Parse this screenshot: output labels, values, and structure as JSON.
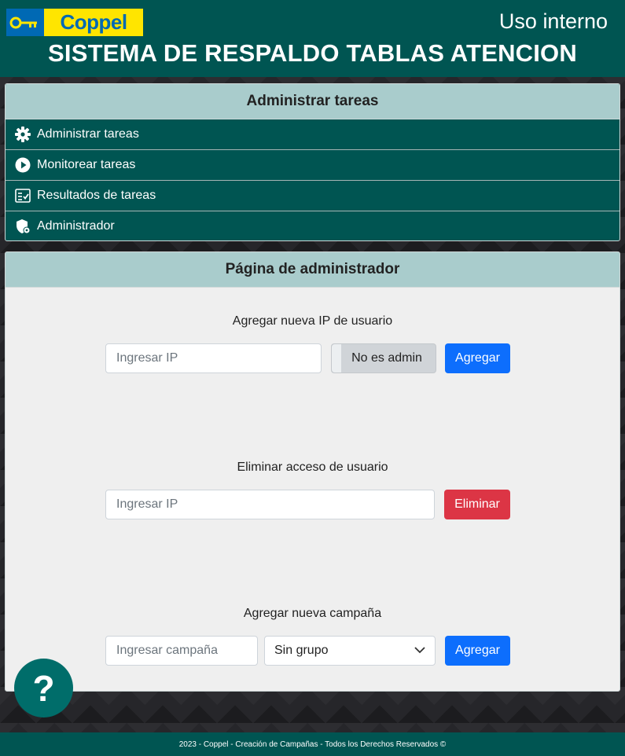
{
  "header": {
    "brand": "Coppel",
    "tag": "Uso interno",
    "title": "SISTEMA DE RESPALDO TABLAS ATENCION"
  },
  "menu": {
    "title": "Administrar tareas",
    "items": [
      {
        "label": "Administrar tareas",
        "icon": "gear-icon"
      },
      {
        "label": "Monitorear tareas",
        "icon": "play-circle-icon"
      },
      {
        "label": "Resultados de tareas",
        "icon": "checklist-icon"
      },
      {
        "label": "Administrador",
        "icon": "admin-shield-icon"
      }
    ]
  },
  "admin": {
    "title": "Página de administrador",
    "add_ip": {
      "label": "Agregar nueva IP de usuario",
      "placeholder": "Ingresar IP",
      "toggle_label": "No es admin",
      "button": "Agregar"
    },
    "remove": {
      "label": "Eliminar acceso de usuario",
      "placeholder": "Ingresar IP",
      "button": "Eliminar"
    },
    "campaign": {
      "label": "Agregar nueva campaña",
      "placeholder": "Ingresar campaña",
      "select_value": "Sin grupo",
      "button": "Agregar"
    }
  },
  "help": {
    "symbol": "?"
  },
  "footer": {
    "text": "2023 - Coppel - Creación de Campañas - Todos los Derechos Reservados ©"
  },
  "colors": {
    "primary_teal": "#005552",
    "header_light": "#a9cccc",
    "button_blue": "#0d6efd",
    "button_red": "#dc3545",
    "brand_yellow": "#ffe500",
    "brand_blue": "#0069b4"
  }
}
